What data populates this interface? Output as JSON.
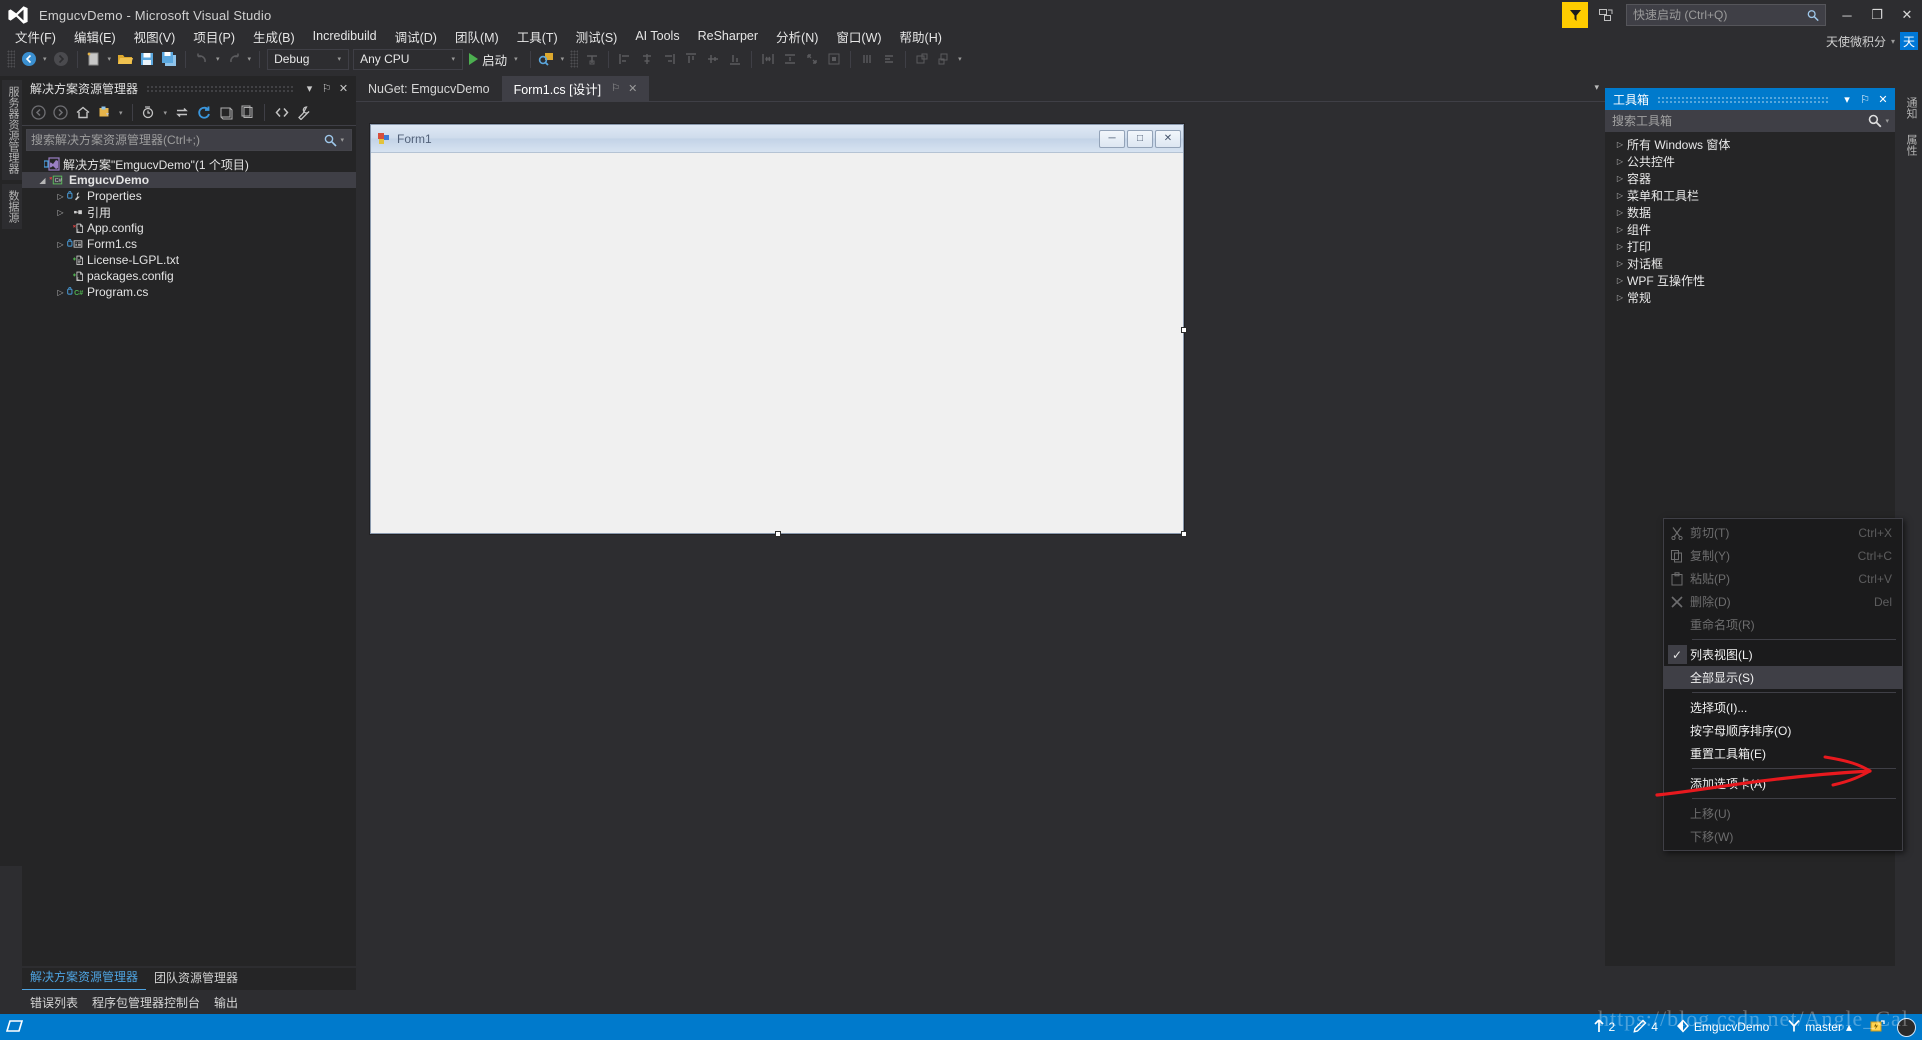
{
  "window": {
    "title": "EmgucvDemo - Microsoft Visual Studio",
    "logo_icon": "visual-studio-logo",
    "minimize_label": "─",
    "maximize_label": "❐",
    "close_label": "✕"
  },
  "titlebar": {
    "feedback_icon": "feedback-flag-icon",
    "notify_icon": "notifications-icon",
    "quick_launch_placeholder": "快速启动 (Ctrl+Q)",
    "quick_launch_value": "",
    "search_icon": "search-icon",
    "account_name": "天使微积分",
    "account_caret": "▾",
    "account_avatar": "天"
  },
  "menubar": {
    "items": [
      {
        "label": "文件(F)",
        "name": "menu-file"
      },
      {
        "label": "编辑(E)",
        "name": "menu-edit"
      },
      {
        "label": "视图(V)",
        "name": "menu-view"
      },
      {
        "label": "项目(P)",
        "name": "menu-project"
      },
      {
        "label": "生成(B)",
        "name": "menu-build"
      },
      {
        "label": "Incredibuild",
        "name": "menu-incredibuild"
      },
      {
        "label": "调试(D)",
        "name": "menu-debug"
      },
      {
        "label": "团队(M)",
        "name": "menu-team"
      },
      {
        "label": "工具(T)",
        "name": "menu-tools"
      },
      {
        "label": "测试(S)",
        "name": "menu-test"
      },
      {
        "label": "AI Tools",
        "name": "menu-ai-tools"
      },
      {
        "label": "ReSharper",
        "name": "menu-resharper"
      },
      {
        "label": "分析(N)",
        "name": "menu-analyze"
      },
      {
        "label": "窗口(W)",
        "name": "menu-window"
      },
      {
        "label": "帮助(H)",
        "name": "menu-help"
      }
    ]
  },
  "toolbar": {
    "back_icon": "navigate-back-icon",
    "forward_icon": "navigate-forward-icon",
    "new_project_icon": "new-project-icon",
    "open_file_icon": "open-file-icon",
    "save_icon": "save-icon",
    "save_all_icon": "save-all-icon",
    "undo_icon": "undo-icon",
    "redo_icon": "redo-icon",
    "configuration": "Debug",
    "platform": "Any CPU",
    "start_label": "启动",
    "start_icon": "play-icon",
    "dropdown_caret": "▾",
    "layout_icons": [
      "align-lefts-icon",
      "align-centers-icon",
      "align-rights-icon",
      "align-tops-icon",
      "align-middles-icon",
      "align-bottoms-icon",
      "make-same-width-icon",
      "make-same-height-icon",
      "size-to-grid-icon",
      "center-in-form-icon",
      "horizontal-spacing-icon",
      "vertical-spacing-icon",
      "bring-to-front-icon",
      "send-to-back-icon"
    ]
  },
  "left_rail": {
    "tabs": [
      {
        "label": "服务器资源管理器",
        "name": "rail-tab-server-explorer"
      },
      {
        "label": "数据源",
        "name": "rail-tab-data-sources"
      }
    ]
  },
  "solution_explorer": {
    "title": "解决方案资源管理器",
    "header_caret": "▾",
    "header_pin": "⚐",
    "header_close": "✕",
    "toolbar_icons": [
      "back-icon",
      "forward-icon",
      "home-icon",
      "pending-changes-filter-icon",
      "show-all-files-icon",
      "sync-with-active-document-icon",
      "refresh-icon",
      "collapse-all-icon",
      "properties-icon",
      "code-view-icon",
      "properties-window-icon"
    ],
    "search_placeholder": "搜索解决方案资源管理器(Ctrl+;)",
    "search_value": "",
    "search_icon": "search-icon",
    "tree": [
      {
        "label": "解决方案\"EmgucvDemo\"(1 个项目)",
        "indent": 0,
        "twist": "",
        "icon": "solution-icon",
        "selected": false,
        "name": "tree-item-solution"
      },
      {
        "label": "EmgucvDemo",
        "indent": 1,
        "twist": "◢",
        "icon": "csharp-project-icon",
        "selected": true,
        "name": "tree-item-project-emgucvdemo"
      },
      {
        "label": "Properties",
        "indent": 2,
        "twist": "▷",
        "icon": "properties-folder-icon",
        "selected": false,
        "name": "tree-item-properties"
      },
      {
        "label": "引用",
        "indent": 2,
        "twist": "▷",
        "icon": "references-icon",
        "selected": false,
        "name": "tree-item-references"
      },
      {
        "label": "App.config",
        "indent": 2,
        "twist": "",
        "icon": "config-file-icon",
        "selected": false,
        "name": "tree-item-app-config"
      },
      {
        "label": "Form1.cs",
        "indent": 2,
        "twist": "▷",
        "icon": "form-file-icon",
        "selected": false,
        "name": "tree-item-form1-cs"
      },
      {
        "label": "License-LGPL.txt",
        "indent": 2,
        "twist": "",
        "icon": "text-file-icon",
        "selected": false,
        "name": "tree-item-license-lgpl-txt"
      },
      {
        "label": "packages.config",
        "indent": 2,
        "twist": "",
        "icon": "config-file-icon",
        "selected": false,
        "name": "tree-item-packages-config"
      },
      {
        "label": "Program.cs",
        "indent": 2,
        "twist": "▷",
        "icon": "csharp-file-icon",
        "selected": false,
        "name": "tree-item-program-cs"
      }
    ],
    "bottom_tabs": [
      {
        "label": "解决方案资源管理器",
        "active": true,
        "name": "bottom-tab-solution-explorer"
      },
      {
        "label": "团队资源管理器",
        "active": false,
        "name": "bottom-tab-team-explorer"
      }
    ]
  },
  "tool_windows": [
    {
      "label": "错误列表",
      "name": "tool-window-error-list"
    },
    {
      "label": "程序包管理器控制台",
      "name": "tool-window-package-manager-console"
    },
    {
      "label": "输出",
      "name": "tool-window-output"
    }
  ],
  "document_tabs": [
    {
      "label": "NuGet: EmgucvDemo",
      "active": false,
      "name": "doc-tab-nuget-emgucvdemo"
    },
    {
      "label": "Form1.cs [设计]",
      "active": true,
      "pin": "⚐",
      "close": "✕",
      "name": "doc-tab-form1-designer"
    }
  ],
  "doc_tab_caret": "▾",
  "winform": {
    "title": "Form1",
    "icon": "form-app-icon",
    "minimize": "─",
    "maximize": "□",
    "close": "✕"
  },
  "toolbox": {
    "title": "工具箱",
    "header_caret": "▾",
    "header_pin": "⚐",
    "header_close": "✕",
    "search_placeholder": "搜索工具箱",
    "search_value": "",
    "search_icon": "search-icon",
    "search_caret": "▾",
    "items": [
      {
        "label": "所有 Windows 窗体",
        "name": "toolbox-group-all-windows-forms"
      },
      {
        "label": "公共控件",
        "name": "toolbox-group-common-controls"
      },
      {
        "label": "容器",
        "name": "toolbox-group-containers"
      },
      {
        "label": "菜单和工具栏",
        "name": "toolbox-group-menus-and-toolbars"
      },
      {
        "label": "数据",
        "name": "toolbox-group-data"
      },
      {
        "label": "组件",
        "name": "toolbox-group-components"
      },
      {
        "label": "打印",
        "name": "toolbox-group-printing"
      },
      {
        "label": "对话框",
        "name": "toolbox-group-dialogs"
      },
      {
        "label": "WPF 互操作性",
        "name": "toolbox-group-wpf-interoperability"
      },
      {
        "label": "常规",
        "name": "toolbox-group-general"
      }
    ],
    "twist": "▷"
  },
  "right_rail": {
    "tabs": [
      {
        "label": "通知",
        "name": "rail-tab-notifications"
      },
      {
        "label": "属性",
        "name": "rail-tab-properties"
      }
    ]
  },
  "context_menu": {
    "items": [
      {
        "label": "剪切(T)",
        "shortcut": "Ctrl+X",
        "icon": "cut-icon",
        "disabled": true,
        "checked": false,
        "highlight": false,
        "name": "ctx-cut"
      },
      {
        "label": "复制(Y)",
        "shortcut": "Ctrl+C",
        "icon": "copy-icon",
        "disabled": true,
        "checked": false,
        "highlight": false,
        "name": "ctx-copy"
      },
      {
        "label": "粘贴(P)",
        "shortcut": "Ctrl+V",
        "icon": "paste-icon",
        "disabled": true,
        "checked": false,
        "highlight": false,
        "name": "ctx-paste"
      },
      {
        "label": "删除(D)",
        "shortcut": "Del",
        "icon": "delete-icon",
        "disabled": true,
        "checked": false,
        "highlight": false,
        "name": "ctx-delete"
      },
      {
        "label": "重命名项(R)",
        "shortcut": "",
        "icon": "",
        "disabled": true,
        "checked": false,
        "highlight": false,
        "name": "ctx-rename-item"
      },
      {
        "separator": true,
        "name": "ctx-separator-1"
      },
      {
        "label": "列表视图(L)",
        "shortcut": "",
        "icon": "",
        "disabled": false,
        "checked": true,
        "highlight": false,
        "name": "ctx-list-view"
      },
      {
        "label": "全部显示(S)",
        "shortcut": "",
        "icon": "",
        "disabled": false,
        "checked": false,
        "highlight": true,
        "name": "ctx-show-all"
      },
      {
        "separator": true,
        "name": "ctx-separator-2"
      },
      {
        "label": "选择项(I)...",
        "shortcut": "",
        "icon": "",
        "disabled": false,
        "checked": false,
        "highlight": false,
        "name": "ctx-choose-items"
      },
      {
        "label": "按字母顺序排序(O)",
        "shortcut": "",
        "icon": "",
        "disabled": false,
        "checked": false,
        "highlight": false,
        "name": "ctx-sort-alphabetically"
      },
      {
        "label": "重置工具箱(E)",
        "shortcut": "",
        "icon": "",
        "disabled": false,
        "checked": false,
        "highlight": false,
        "name": "ctx-reset-toolbox"
      },
      {
        "separator": true,
        "name": "ctx-separator-3"
      },
      {
        "label": "添加选项卡(A)",
        "shortcut": "",
        "icon": "",
        "disabled": false,
        "checked": false,
        "highlight": false,
        "name": "ctx-add-tab"
      },
      {
        "separator": true,
        "name": "ctx-separator-4"
      },
      {
        "label": "上移(U)",
        "shortcut": "",
        "icon": "",
        "disabled": true,
        "checked": false,
        "highlight": false,
        "name": "ctx-move-up"
      },
      {
        "label": "下移(W)",
        "shortcut": "",
        "icon": "",
        "disabled": true,
        "checked": false,
        "highlight": false,
        "name": "ctx-move-down"
      }
    ],
    "check_glyph": "✓"
  },
  "annotation": {
    "arrow_color": "#e8191e",
    "arrow_name": "red-annotation-arrow"
  },
  "watermark": {
    "text": "https://blog.csdn.net/Angle_Cal"
  },
  "statusbar": {
    "ready_icon": "ready-icon",
    "publish_count": "2",
    "publish_icon": "up-arrow-icon",
    "changes_count": "4",
    "changes_icon": "pencil-icon",
    "repo_icon": "source-control-icon",
    "repo_name": "EmgucvDemo",
    "branch_icon": "branch-icon",
    "branch_name": "master",
    "branch_caret": "▴",
    "notify_icon": "notification-bell-icon",
    "avatar_icon": "user-avatar-icon"
  },
  "colors": {
    "accent": "#007acc",
    "chrome": "#2d2d30",
    "panel": "#252526",
    "selection": "#3f3f46",
    "feedback": "#ffcc00",
    "red": "#e8191e"
  }
}
